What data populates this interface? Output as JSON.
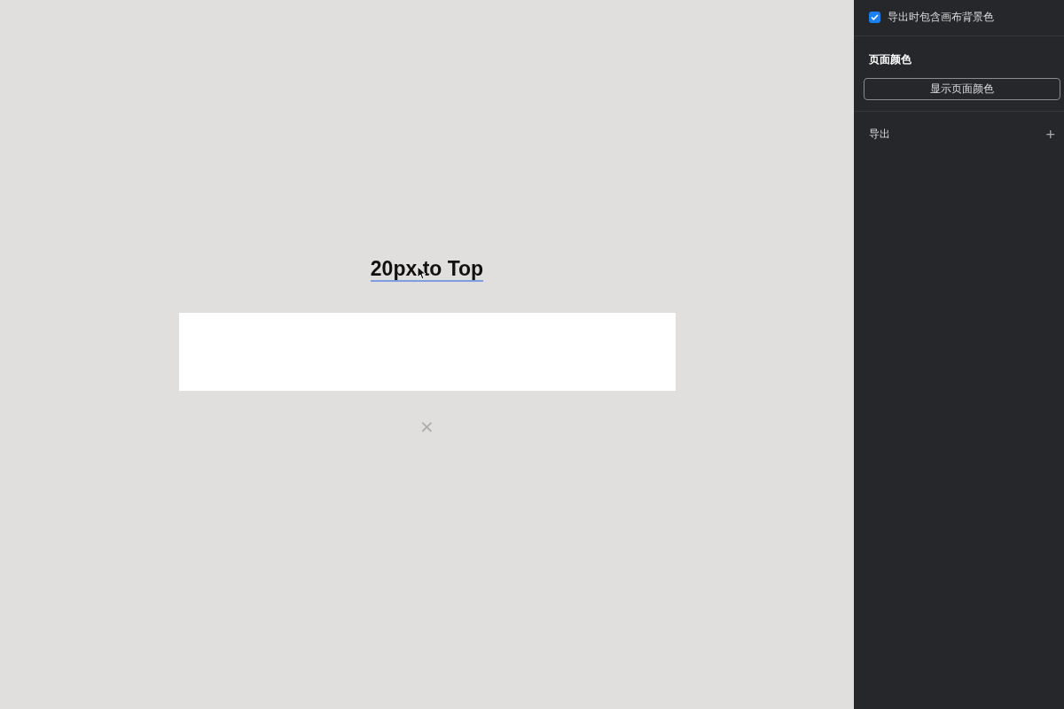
{
  "canvas": {
    "heading": "20px to Top",
    "close_mark": "×"
  },
  "panel": {
    "include_background": {
      "label": "导出时包含画布背景色",
      "checked": true
    },
    "page_color": {
      "title": "页面颜色",
      "button": "显示页面颜色"
    },
    "export": {
      "title": "导出",
      "add": "+"
    }
  }
}
